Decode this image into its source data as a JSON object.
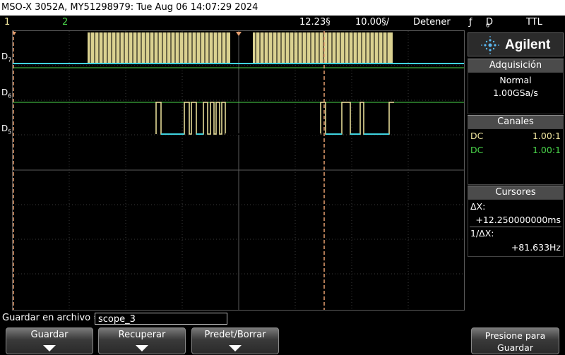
{
  "title": "MSO-X 3052A, MY51298979: Tue Aug 06 14:07:29 2024",
  "status": {
    "ch1": "1",
    "ch2": "2",
    "time_offset": "12.23§",
    "time_scale": "10.00§/",
    "run_state": "Detener",
    "trigger_icon": "trigger-edge-icon",
    "trigger_symbol": "ƒ",
    "trigger_source": "D",
    "trigger_source_num": "6",
    "trigger_level": "TTL"
  },
  "channels_left": [
    {
      "label": "D",
      "num": "7"
    },
    {
      "label": "D",
      "num": "6"
    },
    {
      "label": "D",
      "num": "5"
    }
  ],
  "panel": {
    "brand": "Agilent",
    "acq_header": "Adquisición",
    "acq_mode": "Normal",
    "acq_rate": "1.00GSa/s",
    "ch_header": "Canales",
    "ch1_coupling": "DC",
    "ch1_probe": "1.00:1",
    "ch2_coupling": "DC",
    "ch2_probe": "1.00:1",
    "cur_header": "Cursores",
    "dx_label": "ΔX:",
    "dx_value": "+12.250000000ms",
    "inv_label": "1/ΔX:",
    "inv_value": "+81.633Hz"
  },
  "bottom": {
    "save_label": "Guardar en archivo =",
    "save_value": "scope_3",
    "softkeys": [
      "Guardar",
      "Recuperar",
      "Predet/Borrar",
      "Presione para Guardar"
    ]
  },
  "colors": {
    "ch1": "#f2e8a0",
    "ch2": "#4ad64a",
    "digital_high": "#f2e8a0",
    "digital_low": "#3fd3e0",
    "cursor": "#e8a070"
  }
}
